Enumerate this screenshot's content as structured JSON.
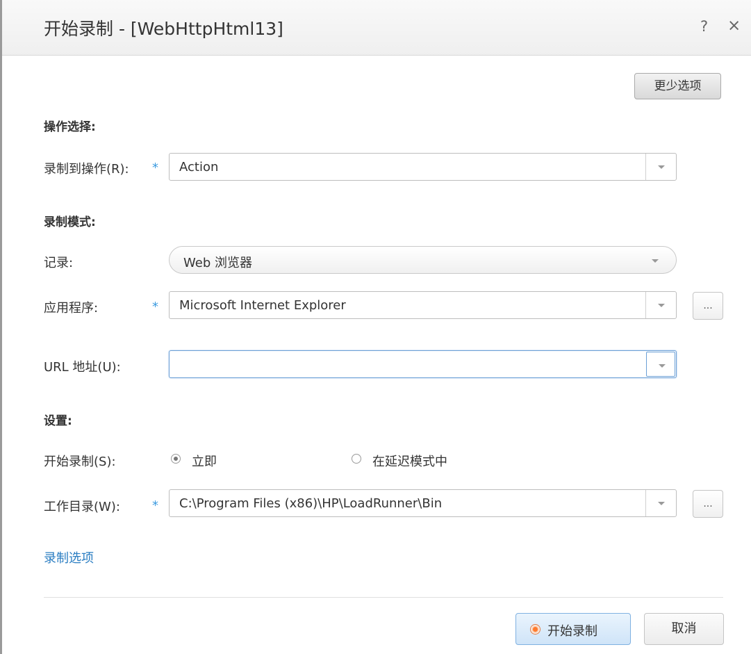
{
  "dialog": {
    "title": "开始录制 - [WebHttpHtml13]",
    "help_glyph": "?",
    "close_glyph": "×"
  },
  "fewer_options_label": "更少选项",
  "action_section": {
    "title": "操作选择:",
    "record_to_action_label": "录制到操作(R):",
    "record_to_action_value": "Action"
  },
  "mode_section": {
    "title": "录制模式:",
    "record_label": "记录:",
    "record_value": "Web 浏览器",
    "application_label": "应用程序:",
    "application_value": "Microsoft Internet Explorer",
    "url_label": "URL 地址(U):",
    "url_value": ""
  },
  "settings_section": {
    "title": "设置:",
    "start_recording_label": "开始录制(S):",
    "option_immediate": "立即",
    "option_delayed": "在延迟模式中",
    "selected": "立即",
    "working_dir_label": "工作目录(W):",
    "working_dir_value": "C:\\Program Files (x86)\\HP\\LoadRunner\\Bin"
  },
  "required_mark": "*",
  "browse_label": "...",
  "recording_options_link": "录制选项",
  "buttons": {
    "start_recording": "开始录制",
    "cancel": "取消"
  },
  "colors": {
    "accent_blue": "#2a7dc2",
    "required_star": "#3b9be0",
    "record_dot": "#ff7a2e"
  }
}
